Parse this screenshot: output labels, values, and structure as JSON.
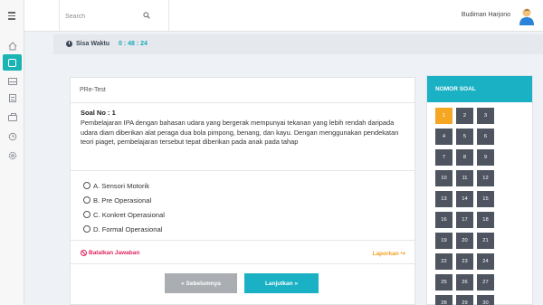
{
  "header": {
    "search_placeholder": "Search",
    "user_name": "Budiman Harjono"
  },
  "timer": {
    "label": "Sisa Waktu",
    "value": "0 : 48 : 24"
  },
  "card": {
    "title": "PRe-Test",
    "question_no": "Soal No : 1",
    "question_text": "Pembelajaran IPA dengan bahasan udara yang bergerak mempunyai tekanan yang lebih rendah daripada udara diam diberikan alat peraga dua bola pimpong, benang, dan kayu. Dengan menggunakan pendekatan teori piaget, pembelajaran tersebut tepat diberikan pada anak pada tahap",
    "options": [
      "A. Sensori Motorik",
      "B. Pre Operasional",
      "C. Konkret Operasional",
      "D. Formal Operasional"
    ],
    "cancel_label": "Batalkan Jawaban",
    "report_label": "Laporkan",
    "prev_label": "« Sebelumnya",
    "next_label": "Lanjutkan »"
  },
  "panel": {
    "title": "NOMOR SOAL",
    "current": "1",
    "numbers": [
      "1",
      "2",
      "3",
      "4",
      "5",
      "6",
      "7",
      "8",
      "9",
      "10",
      "11",
      "12",
      "13",
      "14",
      "15",
      "16",
      "17",
      "18",
      "19",
      "20",
      "21",
      "22",
      "23",
      "24",
      "25",
      "26",
      "27",
      "28",
      "29",
      "30"
    ]
  },
  "colors": {
    "accent": "#1ab1c4",
    "current_number": "#f5a623",
    "number_bg": "#4e5460",
    "danger": "#e0245e",
    "warning": "#f0a020"
  }
}
